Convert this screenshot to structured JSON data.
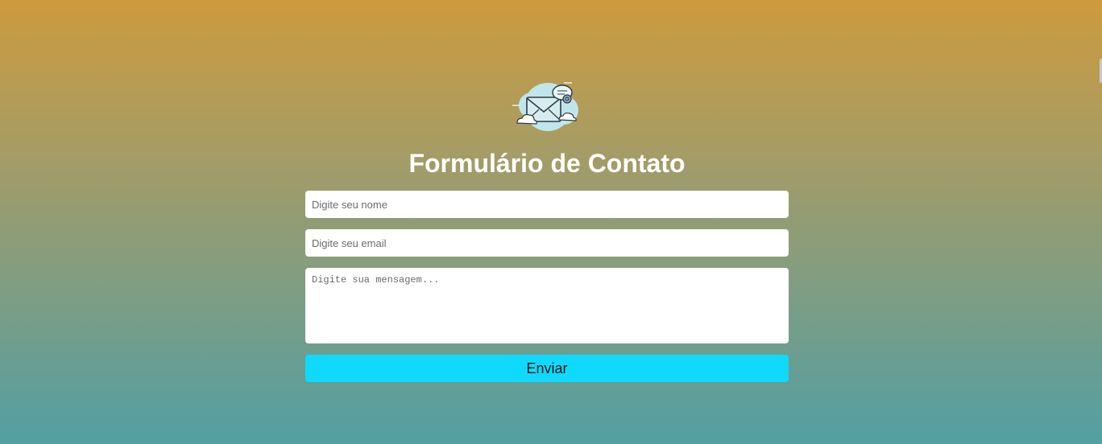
{
  "page": {
    "title": "Formulário de Contato"
  },
  "form": {
    "name_placeholder": "Digite seu nome",
    "name_value": "",
    "email_placeholder": "Digite seu email",
    "email_value": "",
    "message_placeholder": "Digite sua mensagem...",
    "message_value": "",
    "submit_label": "Enviar"
  },
  "colors": {
    "gradient_top": "#cd9b3d",
    "gradient_bottom": "#539fa3",
    "button": "#0fd9ff",
    "title": "#ffffff"
  },
  "icons": {
    "logo": "mail-cloud-icon"
  }
}
